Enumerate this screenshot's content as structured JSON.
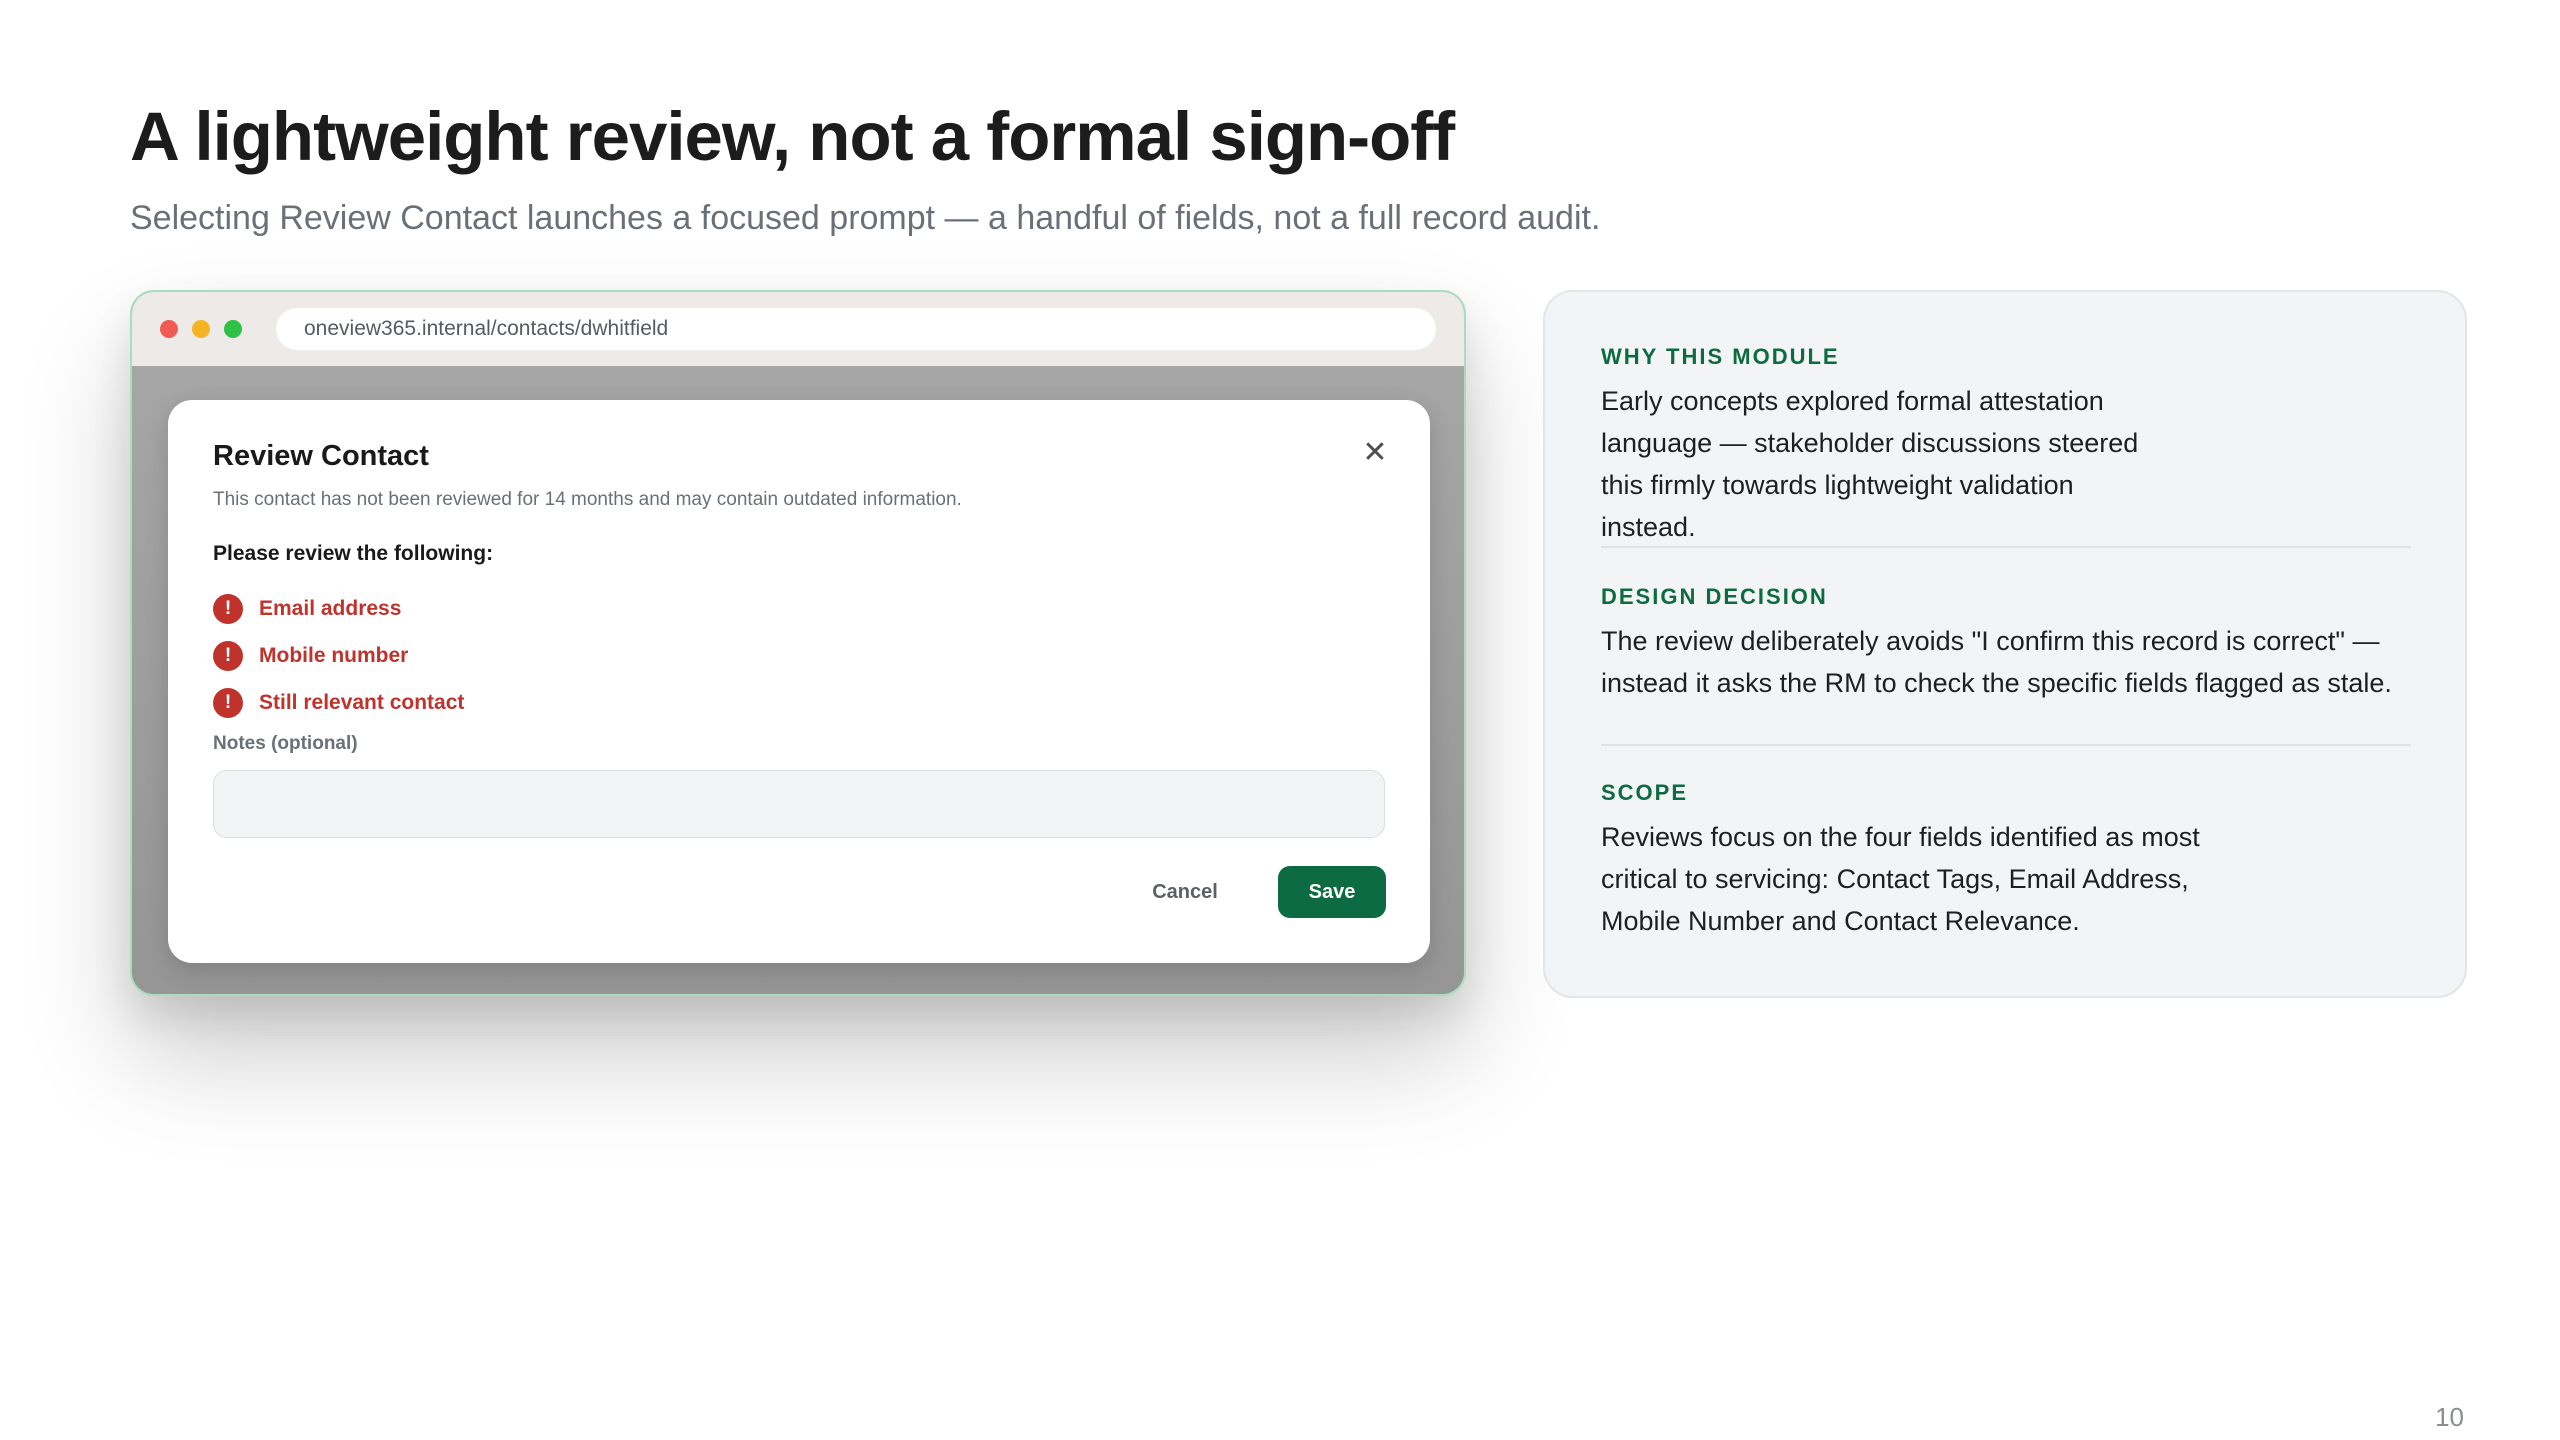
{
  "slide": {
    "title": "A lightweight review, not a formal sign-off",
    "subtitle": "Selecting Review Contact launches a focused prompt — a handful of fields, not a full record audit.",
    "page_number": "10"
  },
  "browser": {
    "url": "oneview365.internal/contacts/dwhitfield"
  },
  "modal": {
    "title": "Review Contact",
    "close_icon": "close-icon",
    "description": "This contact has not been reviewed for 14 months and may contain outdated information.",
    "review_heading": "Please review the following:",
    "review_items": [
      {
        "label": "Email address",
        "icon": "alert-icon",
        "icon_glyph": "!"
      },
      {
        "label": "Mobile number",
        "icon": "alert-icon",
        "icon_glyph": "!"
      },
      {
        "label": "Still relevant contact",
        "icon": "alert-icon",
        "icon_glyph": "!"
      }
    ],
    "notes_label": "Notes (optional)",
    "notes_value": "",
    "notes_placeholder": "",
    "cancel_label": "Cancel",
    "save_label": "Save"
  },
  "info_panel": {
    "sections": [
      {
        "heading": "WHY THIS MODULE",
        "body": "Early concepts explored formal attestation language — stakeholder discussions steered this firmly towards lightweight validation instead."
      },
      {
        "heading": "DESIGN DECISION",
        "body": "The review deliberately avoids \"I confirm this record is correct\" — instead it asks the RM to check the specific fields flagged as stale."
      },
      {
        "heading": "SCOPE",
        "body": "Reviews focus on the four fields identified as most critical to servicing: Contact Tags, Email Address, Mobile Number and Contact Relevance."
      }
    ]
  },
  "colors": {
    "accent_green": "#0d6b41",
    "alert_red": "#c0332d",
    "browser_border": "#a8dcc4"
  }
}
